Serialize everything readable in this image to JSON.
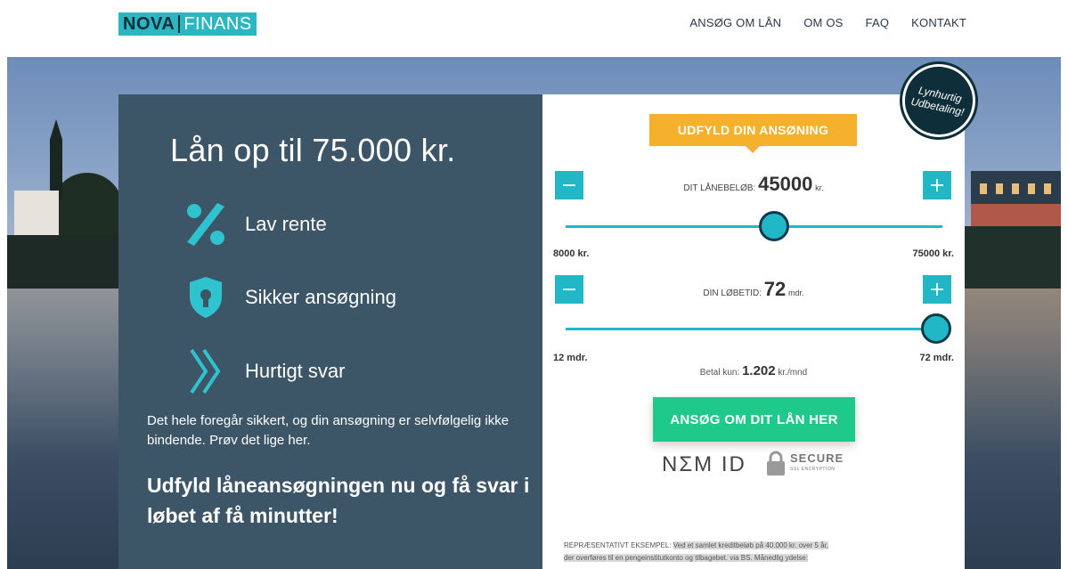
{
  "brand": {
    "part1": "NOVA",
    "part2": "FINANS"
  },
  "nav": [
    "ANSØG OM LÅN",
    "OM OS",
    "FAQ",
    "KONTAKT"
  ],
  "left": {
    "headline": "Lån op til 75.000 kr.",
    "features": [
      {
        "icon": "percent-icon",
        "label": "Lav rente"
      },
      {
        "icon": "shield-lock-icon",
        "label": "Sikker ansøgning"
      },
      {
        "icon": "double-chevron-icon",
        "label": "Hurtigt svar"
      }
    ],
    "description": "Det hele foregår sikkert, og din ansøgning er selvfølgelig ikke bindende. Prøv det lige her.",
    "cta": "Udfyld låneansøgningen nu og få svar i løbet af få minutter!"
  },
  "form": {
    "tag": "UDFYLD DIN ANSØNING",
    "badge_line1": "Lynhurtig",
    "badge_line2": "Udbetaling!",
    "amount": {
      "label": "DIT LÅNEBELØB:",
      "value": "45000",
      "unit": "kr.",
      "min_label": "8000 kr.",
      "max_label": "75000 kr.",
      "min": 8000,
      "max": 75000,
      "current": 45000
    },
    "term": {
      "label": "DIN LØBETID:",
      "value": "72",
      "unit": "mdr.",
      "min_label": "12 mdr.",
      "max_label": "72 mdr.",
      "min": 12,
      "max": 72,
      "current": 72
    },
    "pay_label": "Betal kun:",
    "pay_value": "1.202",
    "pay_unit": "kr./mnd",
    "apply": "ANSØG OM DIT LÅN HER",
    "nemid": "NΣM ID",
    "secure": "SECURE",
    "secure_sub": "SSL ENCRYPTION",
    "rep_label": "REPRÆSENTATIVT EKSEMPEL:",
    "rep_text1": "Ved et samlet kreditbeløb på 40.000 kr. over 5 år,",
    "rep_text2": "der overføres til en pengeinstitutkonto og tilbagebet. via BS. Månedlig ydelse:"
  },
  "colors": {
    "teal": "#21b7c6",
    "orange": "#f5b12c",
    "green": "#1fc98a",
    "panel": "#3c5567"
  }
}
